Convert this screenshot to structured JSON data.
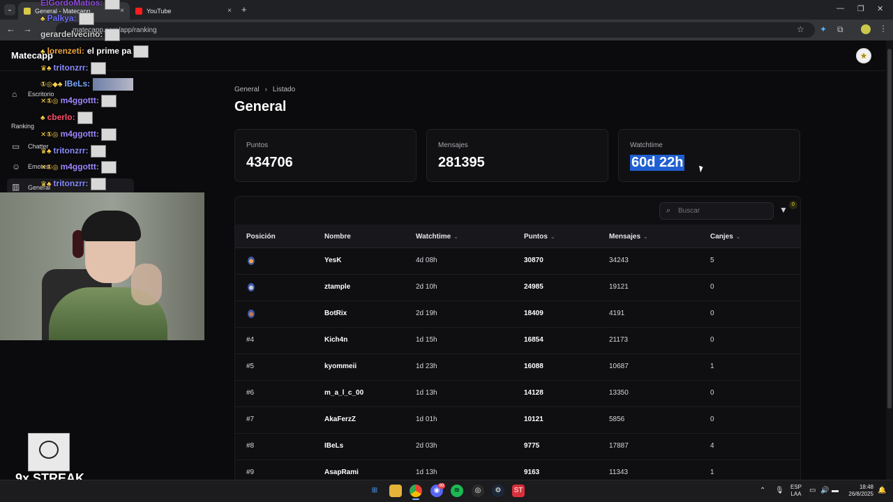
{
  "browser": {
    "tabs": [
      {
        "title": "General - Matecapp",
        "active": true
      },
      {
        "title": "YouTube",
        "active": false
      }
    ],
    "url": "matecapp.com/app/ranking",
    "new_tab": "+",
    "close": "×"
  },
  "app": {
    "brand": "Matecapp",
    "sidebar": [
      {
        "label": "Escritorio",
        "icon": "home-icon"
      },
      {
        "label": "Ranking",
        "icon": ""
      },
      {
        "label": "Chatter",
        "icon": "chat-icon"
      },
      {
        "label": "Emotes",
        "icon": "smile-icon"
      },
      {
        "label": "General",
        "icon": "bar-chart-icon",
        "active": true
      }
    ],
    "breadcrumb": [
      "General",
      "Listado"
    ],
    "title": "General",
    "stats": [
      {
        "label": "Puntos",
        "value": "434706"
      },
      {
        "label": "Mensajes",
        "value": "281395"
      },
      {
        "label": "Watchtime",
        "value": "60d 22h"
      }
    ],
    "search_placeholder": "Buscar",
    "filter_count": "0",
    "columns": [
      "Posición",
      "Nombre",
      "Watchtime",
      "Puntos",
      "Mensajes",
      "Canjes"
    ],
    "rows": [
      {
        "pos": "",
        "medal": "gold",
        "name": "YesK",
        "watchtime": "4d 08h",
        "points": "30870",
        "messages": "34243",
        "redeems": "5"
      },
      {
        "pos": "",
        "medal": "silver",
        "name": "ztample",
        "watchtime": "2d 10h",
        "points": "24985",
        "messages": "19121",
        "redeems": "0"
      },
      {
        "pos": "",
        "medal": "bronze",
        "name": "BotRix",
        "watchtime": "2d 19h",
        "points": "18409",
        "messages": "4191",
        "redeems": "0"
      },
      {
        "pos": "#4",
        "medal": "",
        "name": "Kich4n",
        "watchtime": "1d 15h",
        "points": "16854",
        "messages": "21173",
        "redeems": "0"
      },
      {
        "pos": "#5",
        "medal": "",
        "name": "kyommeii",
        "watchtime": "1d 23h",
        "points": "16088",
        "messages": "10687",
        "redeems": "1"
      },
      {
        "pos": "#6",
        "medal": "",
        "name": "m_a_l_c_00",
        "watchtime": "1d 13h",
        "points": "14128",
        "messages": "13350",
        "redeems": "0"
      },
      {
        "pos": "#7",
        "medal": "",
        "name": "AkaFerzZ",
        "watchtime": "1d 01h",
        "points": "10121",
        "messages": "5856",
        "redeems": "0"
      },
      {
        "pos": "#8",
        "medal": "",
        "name": "IBeLs",
        "watchtime": "2d 03h",
        "points": "9775",
        "messages": "17887",
        "redeems": "4"
      },
      {
        "pos": "#9",
        "medal": "",
        "name": "AsapRami",
        "watchtime": "1d 13h",
        "points": "9163",
        "messages": "11343",
        "redeems": "1"
      }
    ]
  },
  "overlay": {
    "chat": [
      {
        "user": "ElGordoMatios",
        "color": "#8d4bd8",
        "badges": "",
        "text": ""
      },
      {
        "user": "Palkya",
        "color": "#6c6cf5",
        "badges": "♣",
        "text": ""
      },
      {
        "user": "gerardelvecino",
        "color": "#d0d0d0",
        "badges": "",
        "text": ""
      },
      {
        "user": "lorenzeti",
        "color": "#f0a53a",
        "badges": "♣",
        "text": "el prime pa"
      },
      {
        "user": "tritonzrr",
        "color": "#8a8cff",
        "badges": "♛♣",
        "text": ""
      },
      {
        "user": "IBeLs",
        "color": "#7aa8ff",
        "badges": "①◎◆♣",
        "text": ""
      },
      {
        "user": "m4ggottt",
        "color": "#9f88ff",
        "badges": "✕①◎",
        "text": ""
      },
      {
        "user": "cberlo",
        "color": "#ff4e6a",
        "badges": "♣",
        "text": ""
      },
      {
        "user": "m4ggottt",
        "color": "#9f88ff",
        "badges": "✕①◎",
        "text": ""
      },
      {
        "user": "tritonzrr",
        "color": "#8a8cff",
        "badges": "♛♣",
        "text": ""
      },
      {
        "user": "m4ggottt",
        "color": "#9f88ff",
        "badges": "✕①◎",
        "text": ""
      },
      {
        "user": "tritonzrr",
        "color": "#8a8cff",
        "badges": "♛♣",
        "text": ""
      }
    ],
    "streak": "9x STREAK"
  },
  "taskbar": {
    "lang": [
      "ESP",
      "LAA"
    ],
    "time": "18:48",
    "date": "26/8/2025",
    "discord_badge": "99"
  }
}
